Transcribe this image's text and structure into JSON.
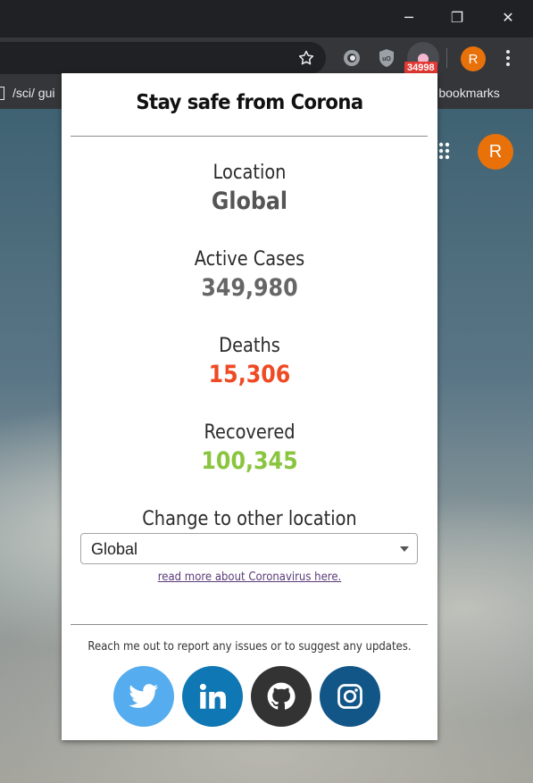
{
  "browser": {
    "bookmark_left": "/sci/ gui",
    "bookmark_right": "er bookmarks",
    "extension_badge": "34998",
    "profile_initial": "R",
    "window_buttons": {
      "minimize": "─",
      "maximize": "❐",
      "close": "✕"
    }
  },
  "page": {
    "profile_initial": "R"
  },
  "popup": {
    "title": "Stay safe from Corona",
    "stats": {
      "location": {
        "label": "Location",
        "value": "Global"
      },
      "active": {
        "label": "Active Cases",
        "value": "349,980"
      },
      "deaths": {
        "label": "Deaths",
        "value": "15,306"
      },
      "recovered": {
        "label": "Recovered",
        "value": "100,345"
      }
    },
    "change_location_label": "Change to other location",
    "location_select": {
      "selected": "Global"
    },
    "read_more_link": "read more about Coronavirus here.",
    "reach_text": "Reach me out to report any issues or to suggest any updates.",
    "social": [
      {
        "icon": "twitter-icon",
        "color": "#55acee"
      },
      {
        "icon": "linkedin-icon",
        "color": "#0e77b4"
      },
      {
        "icon": "github-icon",
        "color": "#333333"
      },
      {
        "icon": "instagram-icon",
        "color": "#125688"
      }
    ]
  },
  "colors": {
    "deaths": "#ee4a24",
    "recovered": "#8ac53f",
    "avatar": "#e8710a",
    "badge": "#e53935"
  }
}
